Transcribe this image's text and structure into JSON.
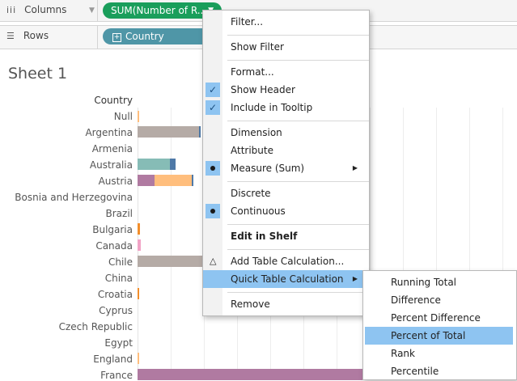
{
  "shelves": {
    "columns_label": "Columns",
    "columns_icon": "iii",
    "columns_pill": "SUM(Number of R...",
    "rows_label": "Rows",
    "rows_icon": "☰",
    "rows_pill": "Country"
  },
  "sheet": {
    "title": "Sheet 1",
    "row_header": "Country",
    "countries": [
      "Null",
      "Argentina",
      "Armenia",
      "Australia",
      "Austria",
      "Bosnia and Herzegovina",
      "Brazil",
      "Bulgaria",
      "Canada",
      "Chile",
      "China",
      "Croatia",
      "Cyprus",
      "Czech Republic",
      "Egypt",
      "England",
      "France"
    ],
    "colors": {
      "taupe": "#b5aba6",
      "teal": "#86bcb6",
      "blue": "#4e79a7",
      "purple": "#b07aa1",
      "orange": "#ffbe7d",
      "pink": "#f1a3c6",
      "orange_dark": "#f28e2b"
    }
  },
  "menu": {
    "items": [
      "Filter...",
      "Show Filter",
      "Format...",
      "Show Header",
      "Include in Tooltip",
      "Dimension",
      "Attribute",
      "Measure (Sum)",
      "Discrete",
      "Continuous",
      "Edit in Shelf",
      "Add Table Calculation...",
      "Quick Table Calculation",
      "Remove"
    ],
    "highlight_color": "#8ec4f1"
  },
  "submenu": {
    "items": [
      "Running Total",
      "Difference",
      "Percent Difference",
      "Percent of Total",
      "Rank",
      "Percentile"
    ],
    "selected": "Percent of Total"
  }
}
